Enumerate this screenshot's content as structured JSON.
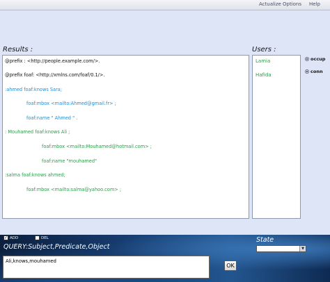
{
  "menu": [
    "Actualize",
    "Options",
    "Help"
  ],
  "results": {
    "label": "Results :",
    "lines": [
      {
        "text": "@prefix :  <http://people.example.com/>.",
        "color": "#111111"
      },
      {
        "text": "@prefix foaf:  <http://xmlns.com/foaf/0.1/>.",
        "color": "#111111"
      },
      {
        "text": ":ahmed  foaf:knows Sara;",
        "color": "#1d8fd8"
      },
      {
        "text": "foaf:mbox <mailto:Ahmed@gmail.fr> ;",
        "color": "#1d8fd8"
      },
      {
        "text": "foaf:name \" Ahmed \" .",
        "color": "#1d8fd8"
      },
      {
        "text": ": Mouhamed foaf:knows Ali ;",
        "color": "#2a9d4a"
      },
      {
        "text": "foaf:mbox <mailto:Mouhamed@hotmail.com> ;",
        "color": "#2a9d4a"
      },
      {
        "text": "foaf:name \"mouhamed\"",
        "color": "#2a9d4a"
      },
      {
        "text": ":salma  foaf:knows  ahmed;",
        "color": "#2a9d4a"
      },
      {
        "text": "foaf:mbox <mailto:salma@yahoo.com> ;",
        "color": "#2a9d4a"
      }
    ]
  },
  "users": {
    "label": "Users :",
    "items": [
      "Lamia",
      "Hafida"
    ]
  },
  "status": {
    "options": [
      "occup",
      "conn"
    ]
  },
  "query": {
    "add_label": "ADD",
    "del_label": "DEL",
    "label": "QUERY:Subject,Predicate,Object",
    "value": "Ali,knows,mouhamed",
    "ok_label": "OK"
  },
  "state": {
    "label": "State"
  }
}
